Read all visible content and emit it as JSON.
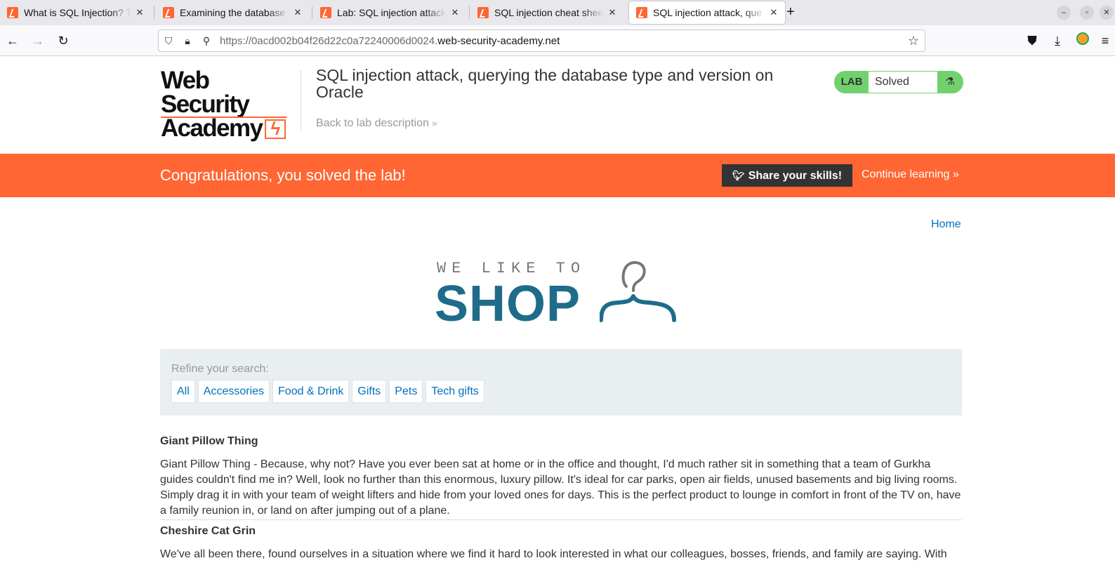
{
  "browser": {
    "tabs": [
      {
        "title": "What is SQL Injection? Tut",
        "active": false
      },
      {
        "title": "Examining the database i",
        "active": false
      },
      {
        "title": "Lab: SQL injection attack,",
        "active": false
      },
      {
        "title": "SQL injection cheat sheet",
        "active": false
      },
      {
        "title": "SQL injection attack, que",
        "active": true
      }
    ],
    "new_tab_label": "+",
    "url_prefix": "https://0acd002b04f26d22c0a72240006d0024.",
    "url_host": "web-security-academy.net",
    "window_controls": [
      "minimize",
      "restore",
      "close"
    ]
  },
  "lab_header": {
    "logo_line1": "Web Security",
    "logo_line2": "Academy",
    "title": "SQL injection attack, querying the database type and version on Oracle",
    "back_link": "Back to lab description",
    "badge_label": "LAB",
    "badge_status": "Solved",
    "badge_color": "#70d16d"
  },
  "banner": {
    "message": "Congratulations, you solved the lab!",
    "share_label": "Share your skills!",
    "continue_label": "Continue learning",
    "color": "#ff6633"
  },
  "nav": {
    "home_label": "Home"
  },
  "shop_logo": {
    "tagline": "WE LIKE TO",
    "word": "SHOP"
  },
  "search": {
    "refine_label": "Refine your search:",
    "filters": [
      "All",
      "Accessories",
      "Food & Drink",
      "Gifts",
      "Pets",
      "Tech gifts"
    ]
  },
  "products": [
    {
      "name": "Giant Pillow Thing",
      "description": "Giant Pillow Thing - Because, why not? Have you ever been sat at home or in the office and thought, I'd much rather sit in something that a team of Gurkha guides couldn't find me in? Well, look no further than this enormous, luxury pillow. It's ideal for car parks, open air fields, unused basements and big living rooms. Simply drag it in with your team of weight lifters and hide from your loved ones for days. This is the perfect product to lounge in comfort in front of the TV on, have a family reunion in, or land on after jumping out of a plane."
    },
    {
      "name": "Cheshire Cat Grin",
      "description": "We've all been there, found ourselves in a situation where we find it hard to look interested in what our colleagues, bosses, friends, and family are saying. With"
    }
  ]
}
